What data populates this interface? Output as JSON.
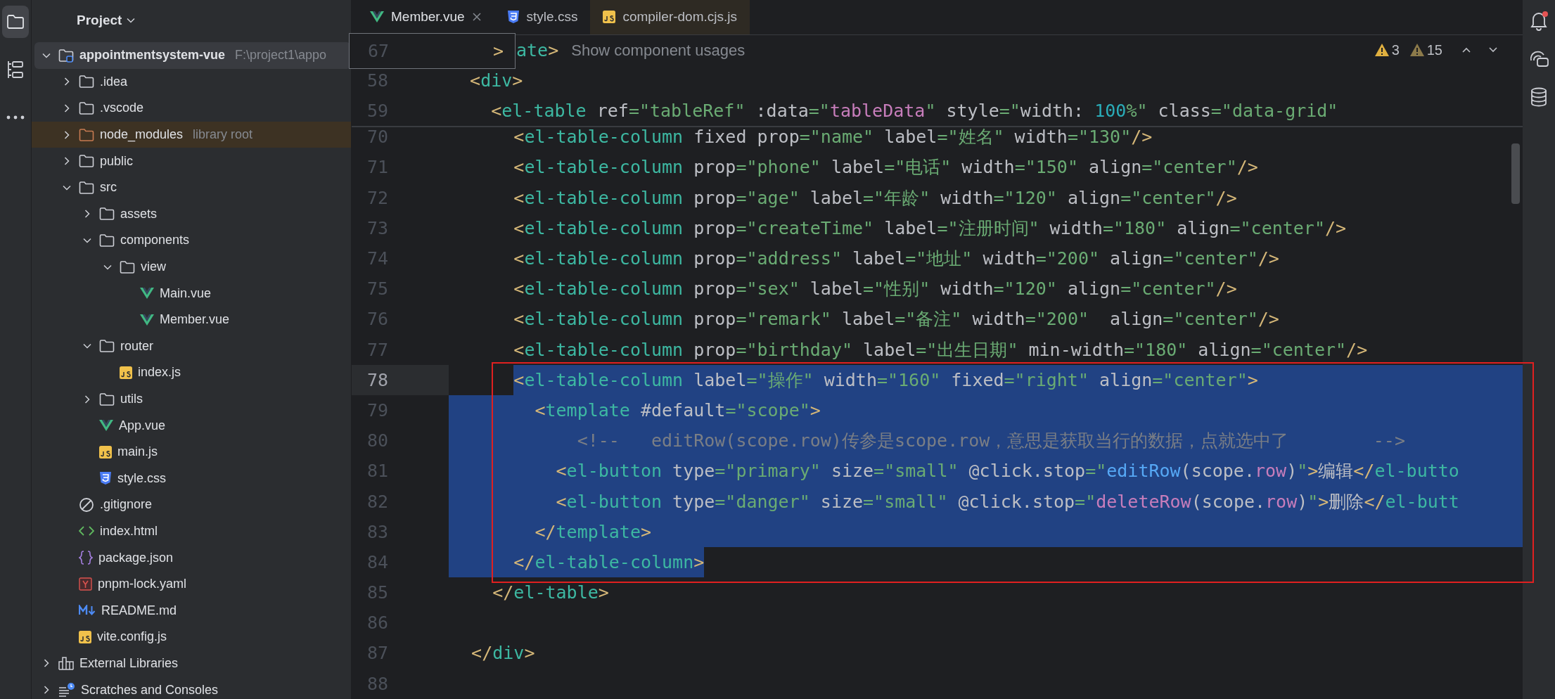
{
  "tool_strip": [
    {
      "kind": "project",
      "selected": true
    },
    {
      "kind": "structure",
      "selected": false
    },
    {
      "kind": "more",
      "selected": false
    }
  ],
  "project_panel": {
    "title": "Project",
    "tree": [
      {
        "name": "appointmentsystem-vue",
        "hint": "F:\\project1\\appo",
        "kind": "project",
        "expanded": true,
        "selected": true,
        "children": [
          {
            "name": ".idea",
            "kind": "folder",
            "expanded": false,
            "selected": false
          },
          {
            "name": ".vscode",
            "kind": "folder",
            "expanded": false,
            "selected": false
          },
          {
            "name": "node_modules",
            "hint": "library root",
            "kind": "library",
            "expanded": false,
            "selected": false
          },
          {
            "name": "public",
            "kind": "folder",
            "expanded": false,
            "selected": false
          },
          {
            "name": "src",
            "kind": "folder",
            "expanded": true,
            "selected": false,
            "children": [
              {
                "name": "assets",
                "kind": "folder",
                "expanded": false,
                "selected": false
              },
              {
                "name": "components",
                "kind": "folder",
                "expanded": true,
                "selected": false,
                "children": [
                  {
                    "name": "view",
                    "kind": "folder",
                    "expanded": true,
                    "selected": false,
                    "children": [
                      {
                        "name": "Main.vue",
                        "kind": "vue",
                        "selected": false
                      },
                      {
                        "name": "Member.vue",
                        "kind": "vue",
                        "selected": false
                      }
                    ]
                  }
                ]
              },
              {
                "name": "router",
                "kind": "folder",
                "expanded": true,
                "selected": false,
                "children": [
                  {
                    "name": "index.js",
                    "kind": "js",
                    "selected": false
                  }
                ]
              },
              {
                "name": "utils",
                "kind": "folder",
                "expanded": false,
                "selected": false
              },
              {
                "name": "App.vue",
                "kind": "vue",
                "selected": false
              },
              {
                "name": "main.js",
                "kind": "js",
                "selected": false
              },
              {
                "name": "style.css",
                "kind": "css",
                "selected": false
              }
            ]
          },
          {
            "name": ".gitignore",
            "kind": "gitignore",
            "selected": false
          },
          {
            "name": "index.html",
            "kind": "html",
            "selected": false
          },
          {
            "name": "package.json",
            "kind": "json",
            "selected": false
          },
          {
            "name": "pnpm-lock.yaml",
            "kind": "yaml",
            "selected": false
          },
          {
            "name": "README.md",
            "kind": "md",
            "selected": false
          },
          {
            "name": "vite.config.js",
            "kind": "js",
            "selected": false
          }
        ]
      },
      {
        "name": "External Libraries",
        "kind": "libraries",
        "expanded": false,
        "selected": false
      },
      {
        "name": "Scratches and Consoles",
        "kind": "scratches",
        "expanded": false,
        "selected": false
      }
    ]
  },
  "tabs": [
    {
      "name": "Member.vue",
      "kind": "vue",
      "selected": true,
      "library": false
    },
    {
      "name": "style.css",
      "kind": "css",
      "selected": false,
      "library": false
    },
    {
      "name": "compiler-dom.cjs.js",
      "kind": "js",
      "selected": false,
      "library": true
    }
  ],
  "problems": [
    {
      "kind": "warning",
      "count": "3"
    },
    {
      "kind": "weak_warning",
      "count": "15"
    }
  ],
  "peek_popup": {
    "number": "67",
    "text": ">"
  },
  "sticky_lines": [
    {
      "tokens": [
        {
          "text": "ate",
          "kind": "tag"
        },
        {
          "text": ">",
          "kind": "br"
        }
      ],
      "hint": "Show component usages"
    },
    {
      "number": "58",
      "tokens": [
        {
          "text": "  <",
          "kind": "br"
        },
        {
          "text": "div",
          "kind": "tag"
        },
        {
          "text": ">",
          "kind": "br"
        }
      ]
    },
    {
      "number": "59",
      "tokens": [
        {
          "text": "    <",
          "kind": "br"
        },
        {
          "text": "el-table",
          "kind": "tag"
        },
        {
          "text": " ref",
          "kind": "attr"
        },
        {
          "text": "=\"tableRef\"",
          "kind": "str"
        },
        {
          "text": " :data",
          "kind": "attr"
        },
        {
          "text": "=\"",
          "kind": "str"
        },
        {
          "text": "tableData",
          "kind": "var"
        },
        {
          "text": "\"",
          "kind": "str"
        },
        {
          "text": " style",
          "kind": "attr"
        },
        {
          "text": "=\"",
          "kind": "str"
        },
        {
          "text": "width: ",
          "kind": "plain"
        },
        {
          "text": "100",
          "kind": "num"
        },
        {
          "text": "%\"",
          "kind": "str"
        },
        {
          "text": " class",
          "kind": "attr"
        },
        {
          "text": "=\"data-grid\"",
          "kind": "str"
        }
      ]
    }
  ],
  "lines": [
    {
      "number": "70",
      "selected": false,
      "current": false,
      "boxed": false,
      "tokens": [
        {
          "text": "      <",
          "kind": "br"
        },
        {
          "text": "el-table-column",
          "kind": "tag"
        },
        {
          "text": " fixed prop",
          "kind": "attr"
        },
        {
          "text": "=\"name\"",
          "kind": "str"
        },
        {
          "text": " label",
          "kind": "attr"
        },
        {
          "text": "=\"姓名\"",
          "kind": "str"
        },
        {
          "text": " width",
          "kind": "attr"
        },
        {
          "text": "=\"130\"",
          "kind": "str"
        },
        {
          "text": "/>",
          "kind": "br"
        }
      ]
    },
    {
      "number": "71",
      "selected": false,
      "current": false,
      "boxed": false,
      "tokens": [
        {
          "text": "      <",
          "kind": "br"
        },
        {
          "text": "el-table-column",
          "kind": "tag"
        },
        {
          "text": " prop",
          "kind": "attr"
        },
        {
          "text": "=\"phone\"",
          "kind": "str"
        },
        {
          "text": " label",
          "kind": "attr"
        },
        {
          "text": "=\"电话\"",
          "kind": "str"
        },
        {
          "text": " width",
          "kind": "attr"
        },
        {
          "text": "=\"150\"",
          "kind": "str"
        },
        {
          "text": " align",
          "kind": "attr"
        },
        {
          "text": "=\"center\"",
          "kind": "str"
        },
        {
          "text": "/>",
          "kind": "br"
        }
      ]
    },
    {
      "number": "72",
      "selected": false,
      "current": false,
      "boxed": false,
      "tokens": [
        {
          "text": "      <",
          "kind": "br"
        },
        {
          "text": "el-table-column",
          "kind": "tag"
        },
        {
          "text": " prop",
          "kind": "attr"
        },
        {
          "text": "=\"age\"",
          "kind": "str"
        },
        {
          "text": " label",
          "kind": "attr"
        },
        {
          "text": "=\"年龄\"",
          "kind": "str"
        },
        {
          "text": " width",
          "kind": "attr"
        },
        {
          "text": "=\"120\"",
          "kind": "str"
        },
        {
          "text": " align",
          "kind": "attr"
        },
        {
          "text": "=\"center\"",
          "kind": "str"
        },
        {
          "text": "/>",
          "kind": "br"
        }
      ]
    },
    {
      "number": "73",
      "selected": false,
      "current": false,
      "boxed": false,
      "tokens": [
        {
          "text": "      <",
          "kind": "br"
        },
        {
          "text": "el-table-column",
          "kind": "tag"
        },
        {
          "text": " prop",
          "kind": "attr"
        },
        {
          "text": "=\"createTime\"",
          "kind": "str"
        },
        {
          "text": " label",
          "kind": "attr"
        },
        {
          "text": "=\"注册时间\"",
          "kind": "str"
        },
        {
          "text": " width",
          "kind": "attr"
        },
        {
          "text": "=\"180\"",
          "kind": "str"
        },
        {
          "text": " align",
          "kind": "attr"
        },
        {
          "text": "=\"center\"",
          "kind": "str"
        },
        {
          "text": "/>",
          "kind": "br"
        }
      ]
    },
    {
      "number": "74",
      "selected": false,
      "current": false,
      "boxed": false,
      "tokens": [
        {
          "text": "      <",
          "kind": "br"
        },
        {
          "text": "el-table-column",
          "kind": "tag"
        },
        {
          "text": " prop",
          "kind": "attr"
        },
        {
          "text": "=\"address\"",
          "kind": "str"
        },
        {
          "text": " label",
          "kind": "attr"
        },
        {
          "text": "=\"地址\"",
          "kind": "str"
        },
        {
          "text": " width",
          "kind": "attr"
        },
        {
          "text": "=\"200\"",
          "kind": "str"
        },
        {
          "text": " align",
          "kind": "attr"
        },
        {
          "text": "=\"center\"",
          "kind": "str"
        },
        {
          "text": "/>",
          "kind": "br"
        }
      ]
    },
    {
      "number": "75",
      "selected": false,
      "current": false,
      "boxed": false,
      "tokens": [
        {
          "text": "      <",
          "kind": "br"
        },
        {
          "text": "el-table-column",
          "kind": "tag"
        },
        {
          "text": " prop",
          "kind": "attr"
        },
        {
          "text": "=\"sex\"",
          "kind": "str"
        },
        {
          "text": " label",
          "kind": "attr"
        },
        {
          "text": "=\"性别\"",
          "kind": "str"
        },
        {
          "text": " width",
          "kind": "attr"
        },
        {
          "text": "=\"120\"",
          "kind": "str"
        },
        {
          "text": " align",
          "kind": "attr"
        },
        {
          "text": "=\"center\"",
          "kind": "str"
        },
        {
          "text": "/>",
          "kind": "br"
        }
      ]
    },
    {
      "number": "76",
      "selected": false,
      "current": false,
      "boxed": false,
      "tokens": [
        {
          "text": "      <",
          "kind": "br"
        },
        {
          "text": "el-table-column",
          "kind": "tag"
        },
        {
          "text": " prop",
          "kind": "attr"
        },
        {
          "text": "=\"remark\"",
          "kind": "str"
        },
        {
          "text": " label",
          "kind": "attr"
        },
        {
          "text": "=\"备注\"",
          "kind": "str"
        },
        {
          "text": " width",
          "kind": "attr"
        },
        {
          "text": "=\"200\"",
          "kind": "str"
        },
        {
          "text": "  align",
          "kind": "attr"
        },
        {
          "text": "=\"center\"",
          "kind": "str"
        },
        {
          "text": "/>",
          "kind": "br"
        }
      ]
    },
    {
      "number": "77",
      "selected": false,
      "current": false,
      "boxed": false,
      "tokens": [
        {
          "text": "      <",
          "kind": "br"
        },
        {
          "text": "el-table-column",
          "kind": "tag"
        },
        {
          "text": " prop",
          "kind": "attr"
        },
        {
          "text": "=\"birthday\"",
          "kind": "str"
        },
        {
          "text": " label",
          "kind": "attr"
        },
        {
          "text": "=\"出生日期\"",
          "kind": "str"
        },
        {
          "text": " min-width",
          "kind": "attr"
        },
        {
          "text": "=\"180\"",
          "kind": "str"
        },
        {
          "text": " align",
          "kind": "attr"
        },
        {
          "text": "=\"center\"",
          "kind": "str"
        },
        {
          "text": "/>",
          "kind": "br"
        }
      ]
    },
    {
      "number": "78",
      "selected": true,
      "selection_start": true,
      "selection_end": false,
      "current": true,
      "boxed": true,
      "tokens": [
        {
          "text": "      <",
          "kind": "br"
        },
        {
          "text": "el-table-column",
          "kind": "tag"
        },
        {
          "text": " label",
          "kind": "attr"
        },
        {
          "text": "=\"操作\"",
          "kind": "str"
        },
        {
          "text": " width",
          "kind": "attr"
        },
        {
          "text": "=\"160\"",
          "kind": "str"
        },
        {
          "text": " fixed",
          "kind": "attr"
        },
        {
          "text": "=\"right\"",
          "kind": "str"
        },
        {
          "text": " align",
          "kind": "attr"
        },
        {
          "text": "=\"center\"",
          "kind": "str"
        },
        {
          "text": ">",
          "kind": "br"
        }
      ]
    },
    {
      "number": "79",
      "selected": true,
      "selection_start": false,
      "selection_end": false,
      "current": false,
      "boxed": true,
      "tokens": [
        {
          "text": "        <",
          "kind": "br"
        },
        {
          "text": "template",
          "kind": "tag"
        },
        {
          "text": " #default",
          "kind": "attr"
        },
        {
          "text": "=\"scope\"",
          "kind": "str"
        },
        {
          "text": ">",
          "kind": "br"
        }
      ]
    },
    {
      "number": "80",
      "selected": true,
      "selection_start": false,
      "selection_end": false,
      "current": false,
      "boxed": true,
      "tokens": [
        {
          "text": "            <!--   editRow(scope.row)传参是scope.row，意思是获取当行的数据，点就选中了        -->",
          "kind": "comment"
        }
      ]
    },
    {
      "number": "81",
      "selected": true,
      "selection_start": false,
      "selection_end": false,
      "current": false,
      "boxed": true,
      "tokens": [
        {
          "text": "          <",
          "kind": "br"
        },
        {
          "text": "el-button",
          "kind": "tag"
        },
        {
          "text": " type",
          "kind": "attr"
        },
        {
          "text": "=\"primary\"",
          "kind": "str"
        },
        {
          "text": " size",
          "kind": "attr"
        },
        {
          "text": "=\"small\"",
          "kind": "str"
        },
        {
          "text": " @click.stop",
          "kind": "attr"
        },
        {
          "text": "=\"",
          "kind": "str"
        },
        {
          "text": "editRow",
          "kind": "fn"
        },
        {
          "text": "(scope.",
          "kind": "plain"
        },
        {
          "text": "row",
          "kind": "var"
        },
        {
          "text": ")",
          "kind": "plain"
        },
        {
          "text": "\"",
          "kind": "str"
        },
        {
          "text": ">",
          "kind": "br"
        },
        {
          "text": "编辑",
          "kind": "plain"
        },
        {
          "text": "</",
          "kind": "br"
        },
        {
          "text": "el-butto",
          "kind": "tag"
        }
      ]
    },
    {
      "number": "82",
      "selected": true,
      "selection_start": false,
      "selection_end": false,
      "current": false,
      "boxed": true,
      "tokens": [
        {
          "text": "          <",
          "kind": "br"
        },
        {
          "text": "el-button",
          "kind": "tag"
        },
        {
          "text": " type",
          "kind": "attr"
        },
        {
          "text": "=\"danger\"",
          "kind": "str"
        },
        {
          "text": " size",
          "kind": "attr"
        },
        {
          "text": "=\"small\"",
          "kind": "str"
        },
        {
          "text": " @click.stop",
          "kind": "attr"
        },
        {
          "text": "=\"",
          "kind": "str"
        },
        {
          "text": "deleteRow",
          "kind": "var"
        },
        {
          "text": "(scope.",
          "kind": "plain"
        },
        {
          "text": "row",
          "kind": "var"
        },
        {
          "text": ")",
          "kind": "plain"
        },
        {
          "text": "\"",
          "kind": "str"
        },
        {
          "text": ">",
          "kind": "br"
        },
        {
          "text": "删除",
          "kind": "plain"
        },
        {
          "text": "</",
          "kind": "br"
        },
        {
          "text": "el-butt",
          "kind": "tag"
        }
      ]
    },
    {
      "number": "83",
      "selected": true,
      "selection_start": false,
      "selection_end": false,
      "current": false,
      "boxed": true,
      "tokens": [
        {
          "text": "        </",
          "kind": "br"
        },
        {
          "text": "template",
          "kind": "tag"
        },
        {
          "text": ">",
          "kind": "br"
        }
      ]
    },
    {
      "number": "84",
      "selected": true,
      "selection_start": false,
      "selection_end": true,
      "current": false,
      "boxed": true,
      "tokens": [
        {
          "text": "      </",
          "kind": "br"
        },
        {
          "text": "el-table-column",
          "kind": "tag"
        },
        {
          "text": ">",
          "kind": "br"
        }
      ]
    },
    {
      "number": "85",
      "selected": false,
      "current": false,
      "boxed": false,
      "tokens": [
        {
          "text": "    </",
          "kind": "br"
        },
        {
          "text": "el-table",
          "kind": "tag"
        },
        {
          "text": ">",
          "kind": "br"
        }
      ]
    },
    {
      "number": "86",
      "selected": false,
      "current": false,
      "boxed": false
    },
    {
      "number": "87",
      "selected": false,
      "current": false,
      "boxed": false,
      "tokens": [
        {
          "text": "  </",
          "kind": "br"
        },
        {
          "text": "div",
          "kind": "tag"
        },
        {
          "text": ">",
          "kind": "br"
        }
      ]
    },
    {
      "number": "88",
      "selected": false,
      "current": false,
      "boxed": false
    }
  ]
}
